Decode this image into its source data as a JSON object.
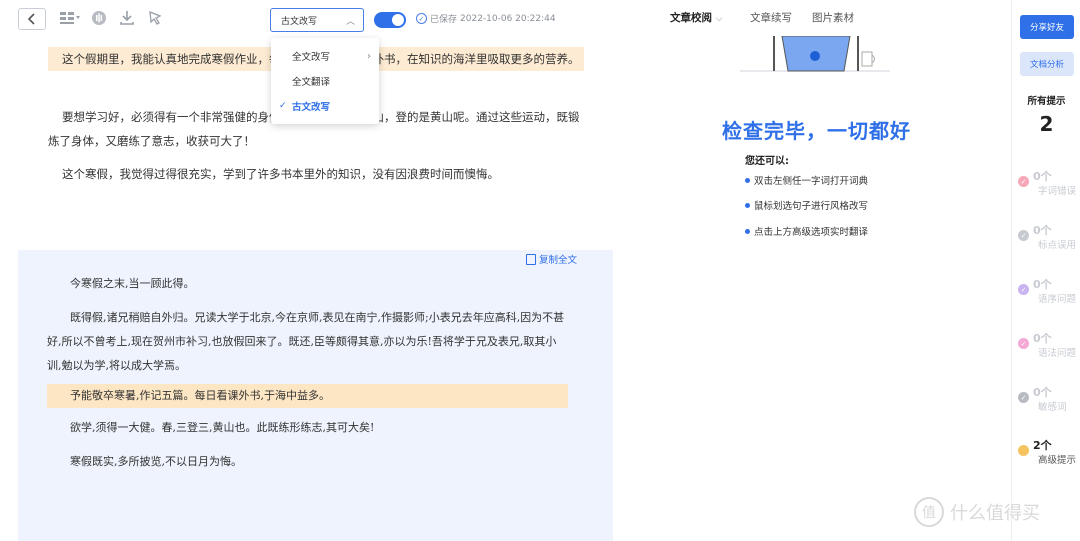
{
  "toolbar": {
    "back_icon": "chevron-left-icon",
    "mode_select_value": "古文改写",
    "saved_label": "已保存",
    "saved_time": "2022-10-06 20:22:44"
  },
  "dropdown": {
    "items": [
      {
        "label": "全文改写",
        "has_submenu": true
      },
      {
        "label": "全文翻译",
        "has_submenu": false
      },
      {
        "label": "古文改写",
        "selected": true
      }
    ]
  },
  "doc_top": {
    "p1": "这个假期里，我能认真地完成寒假作业，每天我都要看一些课外书，在知识的海洋里吸取更多的营养。",
    "p2": "要想学习好，必须得有一个非常强健的身体，我们去登了三次山，登的是黄山呢。通过这些运动，既锻炼了身体，又磨练了意志，收获可大了！",
    "p3": "这个寒假，我觉得过得很充实，学到了许多书本里外的知识，没有因浪费时间而懊悔。"
  },
  "doc_bottom": {
    "copy_label": "复制全文",
    "p1": "今寒假之末,当一顾此得。",
    "p2": "既得假,诸兄稍赔自外归。兄读大学于北京,今在京师,表见在南宁,作摄影师;小表兄去年应高科,因为不甚好,所以不曾考上,现在贺州市补习,也放假回来了。既还,臣等颇得其意,亦以为乐!吾将学于兄及表兄,取其小训,勉以为学,将以成大学焉。",
    "p3": "予能敬卒寒暑,作记五篇。每日看课外书,于海中益多。",
    "p4": "欲学,须得一大健。春,三登三,黄山也。此既练形练志,其可大矣!",
    "p5": "寒假既实,多所披览,不以日月为悔。"
  },
  "right_panel": {
    "tabs": [
      {
        "label": "文章校阅",
        "active": true
      },
      {
        "label": "文章续写",
        "active": false
      },
      {
        "label": "图片素材",
        "active": false
      }
    ],
    "check_title": "检查完毕，一切都好",
    "tips_head": "您还可以:",
    "tips": [
      "双击左侧任一字词打开词典",
      "鼠标划选句子进行风格改写",
      "点击上方高级选项实时翻译"
    ]
  },
  "sidebar": {
    "share_label": "分享好友",
    "analysis_label": "文档分析",
    "all_tips_label": "所有提示",
    "all_tips_count": "2",
    "categories": [
      {
        "count": "0个",
        "label": "字词错误",
        "color": "#f7a8b8"
      },
      {
        "count": "0个",
        "label": "标点误用",
        "color": "#c7cbd1"
      },
      {
        "count": "0个",
        "label": "语序问题",
        "color": "#c9b3f0"
      },
      {
        "count": "0个",
        "label": "语法问题",
        "color": "#f4a9d4"
      },
      {
        "count": "0个",
        "label": "敏感词",
        "color": "#b8bcc2"
      },
      {
        "count": "2个",
        "label": "高级提示",
        "color": "#f5c461"
      }
    ]
  },
  "watermark": {
    "text": "什么值得买",
    "symbol": "值"
  }
}
